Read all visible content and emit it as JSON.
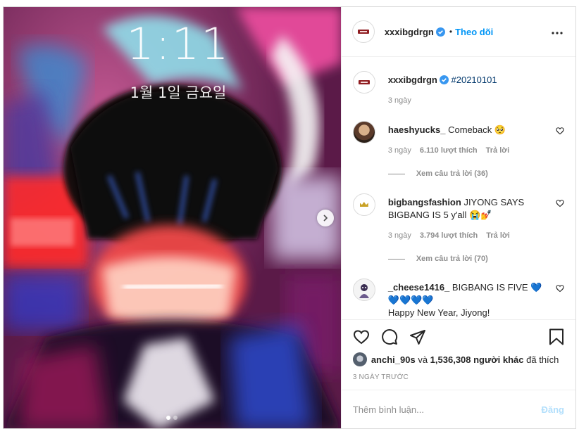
{
  "media": {
    "lock_time": "1:11",
    "lock_date": "1월 1일 금요일",
    "next_icon": "chevron-right-icon",
    "slide_count": 2,
    "active_slide": 1
  },
  "author": {
    "username": "xxxibgdrgn",
    "follow_separator": "•",
    "follow_label": "Theo dõi",
    "more_icon": "more-options-icon"
  },
  "caption": {
    "username": "xxxibgdrgn",
    "text": "#20210101",
    "time": "3 ngày"
  },
  "comments": [
    {
      "username": "haeshyucks_",
      "text": "Comeback 🥺",
      "time": "3 ngày",
      "likes": "6.110 lượt thích",
      "reply_label": "Trả lời",
      "view_replies": "Xem câu trả lời (36)"
    },
    {
      "username": "bigbangsfashion",
      "text": "JIYONG SAYS BIGBANG IS 5 y'all 😭💅",
      "time": "3 ngày",
      "likes": "3.794 lượt thích",
      "reply_label": "Trả lời",
      "view_replies": "Xem câu trả lời (70)"
    },
    {
      "username": "_cheese1416_",
      "text": "BIGBANG IS FIVE 💙💙💙💙💙",
      "text2": "Happy New Year, Jiyong!"
    }
  ],
  "actions": {
    "like_icon": "heart-icon",
    "comment_icon": "comment-icon",
    "share_icon": "send-icon",
    "save_icon": "bookmark-icon"
  },
  "likes_line": {
    "user": "anchi_90s",
    "conj": "và",
    "others": "1,536,308 người khác",
    "suffix": "đã thích"
  },
  "post_date": "3 NGÀY TRƯỚC",
  "add_comment": {
    "placeholder": "Thêm bình luận...",
    "post_label": "Đăng"
  },
  "colors": {
    "accent": "#0095f6",
    "post_disabled": "#b2dffc",
    "muted": "#8e8e8e",
    "brand_logo": "#8f1d21"
  }
}
